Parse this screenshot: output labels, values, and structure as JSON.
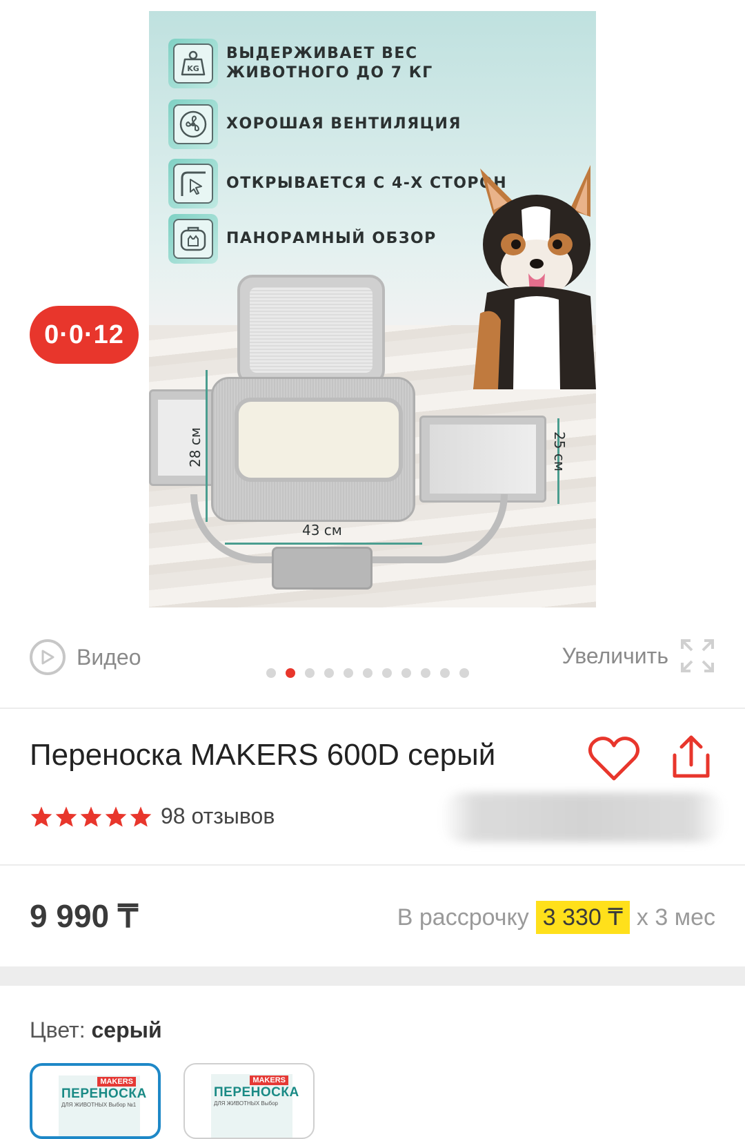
{
  "image": {
    "features": [
      {
        "icon": "weight-kg-icon",
        "text_line1": "ВЫДЕРЖИВАЕТ ВЕС",
        "text_line2": "ЖИВОТНОГО ДО 7 КГ"
      },
      {
        "icon": "fan-icon",
        "text_line1": "ХОРОШАЯ ВЕНТИЛЯЦИЯ",
        "text_line2": ""
      },
      {
        "icon": "cursor-corner-icon",
        "text_line1": "ОТКРЫВАЕТСЯ С 4-Х СТОРОН",
        "text_line2": ""
      },
      {
        "icon": "cat-carrier-icon",
        "text_line1": "ПАНОРАМНЫЙ ОБЗОР",
        "text_line2": ""
      }
    ],
    "dimensions": {
      "height": "28 см",
      "width": "43 см",
      "side": "25 см"
    },
    "kg_label": "KG"
  },
  "timer_badge": "0·0·12",
  "media": {
    "video_label": "Видео",
    "zoom_label": "Увеличить",
    "slide_count": 11,
    "active_slide": 2
  },
  "product": {
    "title": "Переноска MAKERS 600D серый",
    "rating": 5,
    "reviews": "98 отзывов"
  },
  "price": {
    "value": "9 990 ₸",
    "installment_prefix": "В рассрочку",
    "installment_amount": "3 330 ₸",
    "installment_suffix": "х 3 мес"
  },
  "color": {
    "label": "Цвет:",
    "value": "серый",
    "swatches": [
      {
        "brand": "MAKERS",
        "title": "ПЕРЕНОСКА",
        "subtitle": "ДЛЯ ЖИВОТНЫХ  Выбор №1"
      },
      {
        "brand": "MAKERS",
        "title": "ПЕРЕНОСКА",
        "subtitle": "ДЛЯ ЖИВОТНЫХ  Выбор"
      }
    ]
  },
  "colors": {
    "accent_red": "#e8362c",
    "installment_highlight": "#ffe01b",
    "selected_border": "#1e88c7"
  }
}
